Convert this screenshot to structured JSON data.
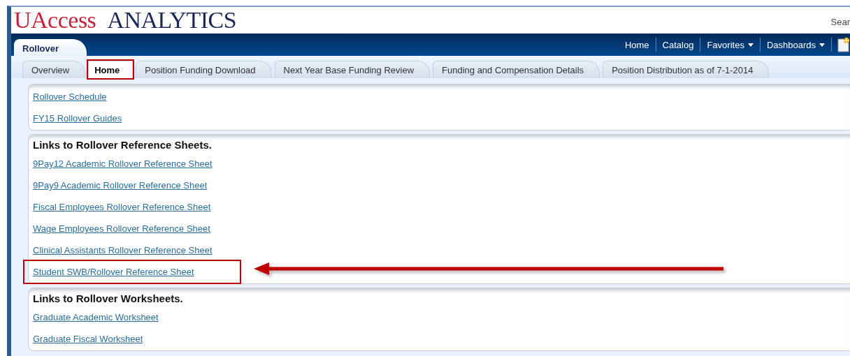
{
  "header": {
    "logo_brand": "UAccess",
    "logo_product": "ANALYTICS",
    "search_label": "Sear"
  },
  "dashboard_tab": {
    "label": "Rollover"
  },
  "nav_links": [
    {
      "label": "Home",
      "kind": "link"
    },
    {
      "label": "Catalog",
      "kind": "link"
    },
    {
      "label": "Favorites",
      "kind": "menu"
    },
    {
      "label": "Dashboards",
      "kind": "menu"
    },
    {
      "kind": "new-icon"
    }
  ],
  "tabs": [
    {
      "label": "Overview",
      "selected": false,
      "highlighted": false
    },
    {
      "label": "Home",
      "selected": true,
      "highlighted": true
    },
    {
      "label": "Position Funding Download",
      "selected": false,
      "highlighted": false
    },
    {
      "label": "Next Year Base Funding Review",
      "selected": false,
      "highlighted": false
    },
    {
      "label": "Funding and Compensation Details",
      "selected": false,
      "highlighted": false
    },
    {
      "label": "Position Distribution as of 7-1-2014",
      "selected": false,
      "highlighted": false
    }
  ],
  "sections": [
    {
      "links": [
        {
          "label": "Rollover Schedule",
          "highlighted": false
        },
        {
          "label": "FY15 Rollover Guides",
          "highlighted": false
        }
      ]
    },
    {
      "heading": "Links to Rollover Reference Sheets.",
      "links": [
        {
          "label": "9Pay12 Academic Rollover Reference Sheet",
          "highlighted": false
        },
        {
          "label": "9Pay9 Academic Rollover Reference Sheet",
          "highlighted": false
        },
        {
          "label": "Fiscal Employees Rollover Reference Sheet",
          "highlighted": false
        },
        {
          "label": "Wage Employees Rollover Reference Sheet",
          "highlighted": false
        },
        {
          "label": "Clinical Assistants Rollover Reference Sheet",
          "highlighted": false
        },
        {
          "label": "Student SWB/Rollover Reference Sheet",
          "highlighted": true
        }
      ]
    },
    {
      "heading": "Links to Rollover Worksheets.",
      "links": [
        {
          "label": "Graduate Academic Worksheet",
          "highlighted": false
        },
        {
          "label": "Graduate Fiscal Worksheet",
          "highlighted": false
        }
      ]
    }
  ]
}
